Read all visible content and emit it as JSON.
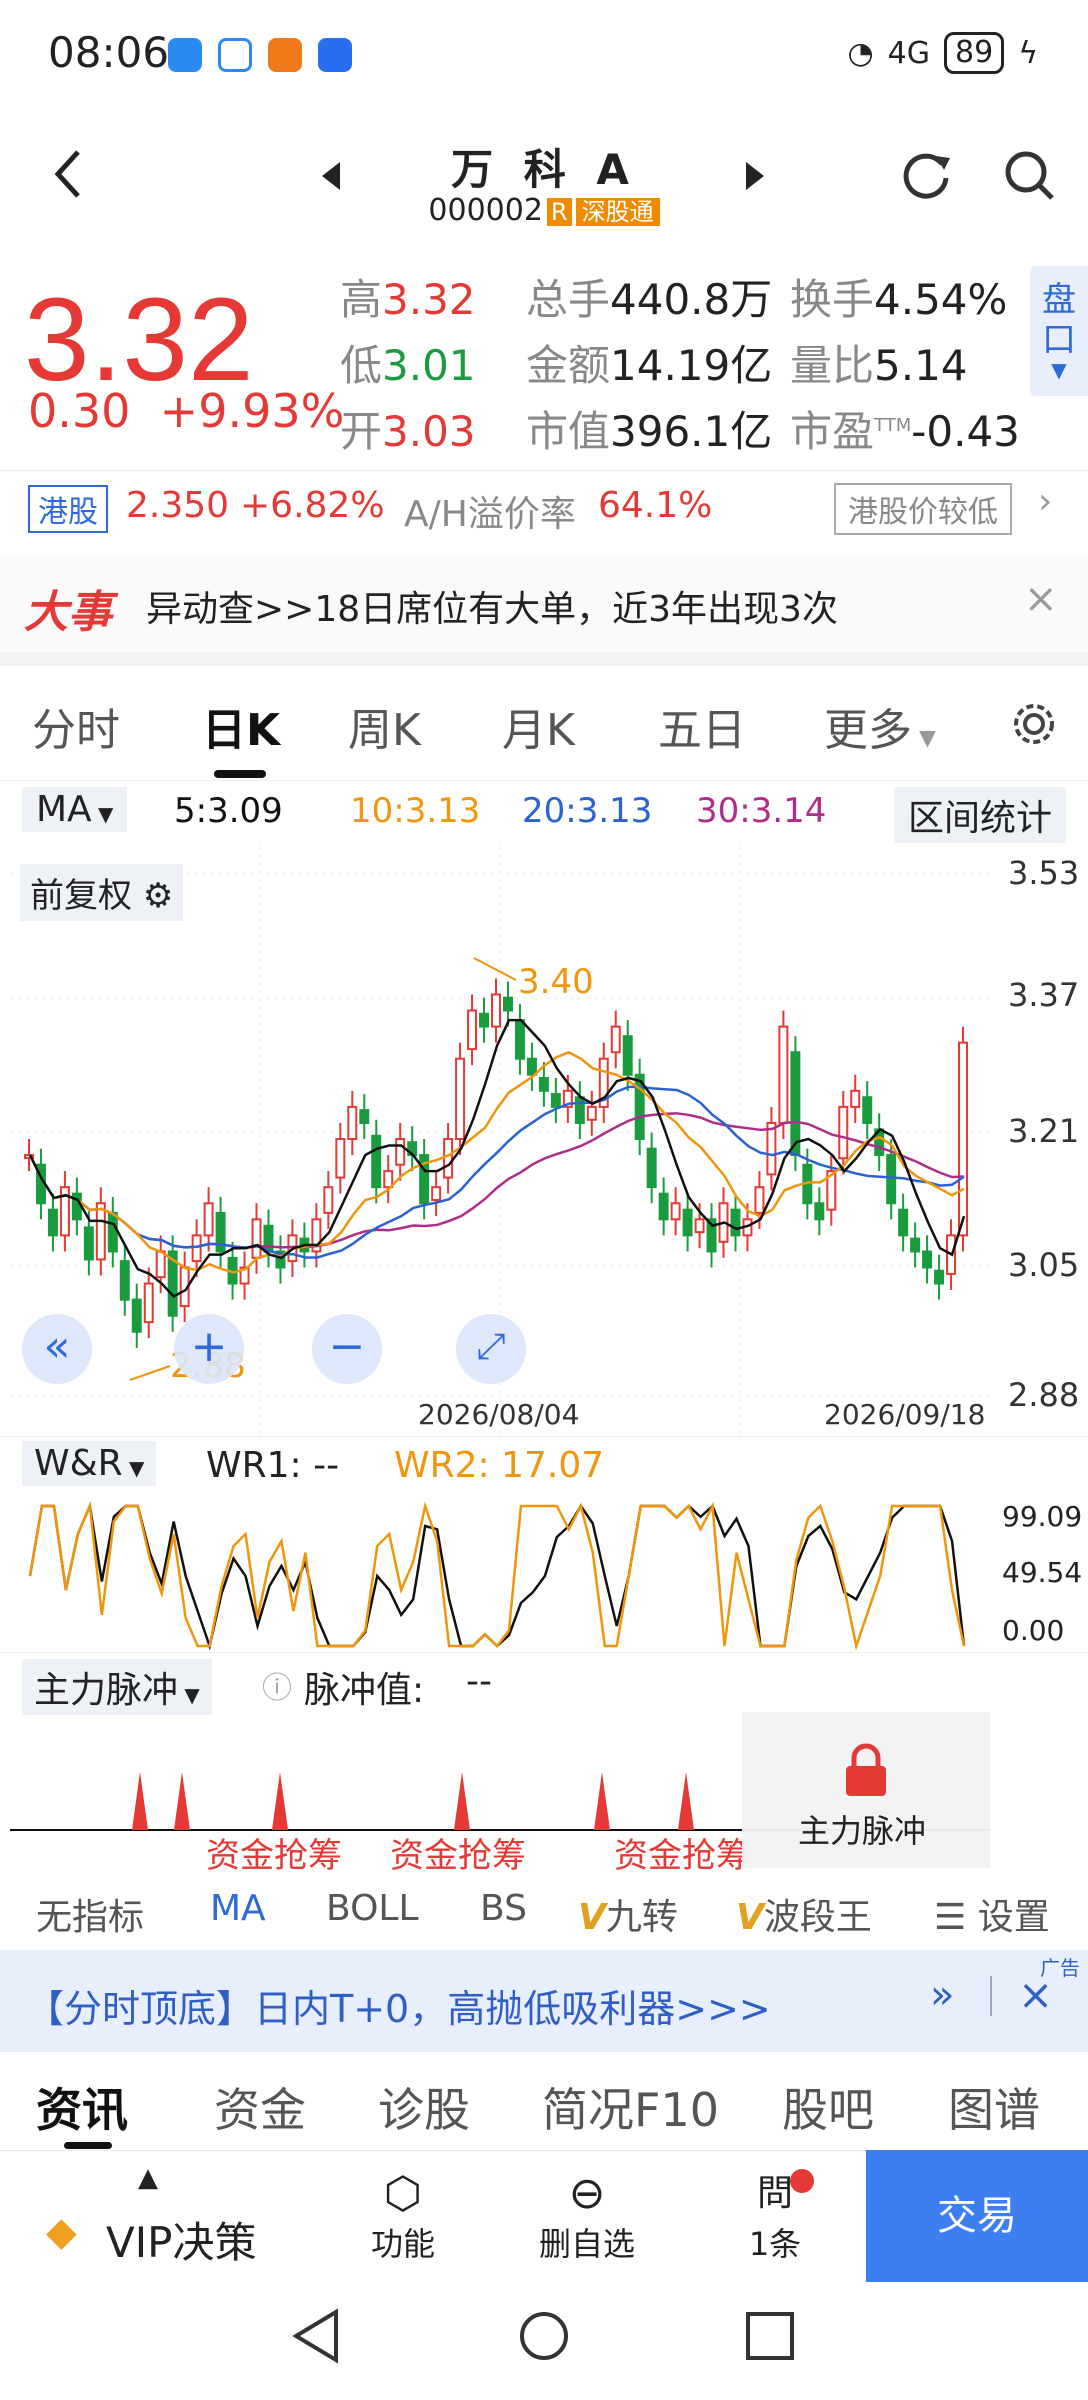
{
  "status_bar": {
    "time": "08:06",
    "network": "4G",
    "battery": "89"
  },
  "header": {
    "title": "万 科 A",
    "code": "000002",
    "tag_r": "R",
    "tag_sz": "深股通"
  },
  "quote": {
    "price": "3.32",
    "change": "0.30",
    "change_pct": "+9.93%",
    "high_label": "高",
    "high": "3.32",
    "low_label": "低",
    "low": "3.01",
    "open_label": "开",
    "open": "3.03",
    "volume_label": "总手",
    "volume": "440.8万",
    "amount_label": "金额",
    "amount": "14.19亿",
    "mcap_label": "市值",
    "mcap": "396.1亿",
    "turnover_label": "换手",
    "turnover": "4.54%",
    "vol_ratio_label": "量比",
    "vol_ratio": "5.14",
    "pe_label": "市盈",
    "pe_sup": "TTM",
    "pe": "-0.43",
    "side_tab": "盘口"
  },
  "hk": {
    "badge": "港股",
    "price": "2.350",
    "pct": "+6.82%",
    "ah_label": "A/H溢价率",
    "ah_value": "64.1%",
    "compare": "港股价较低"
  },
  "event": {
    "tag": "大事",
    "text": "异动查>>18日席位有大单，近3年出现3次"
  },
  "tabs": [
    "分时",
    "日K",
    "周K",
    "月K",
    "五日",
    "更多"
  ],
  "ma": {
    "label": "MA",
    "ma5": "5:3.09",
    "ma10": "10:3.13",
    "ma20": "20:3.13",
    "ma30": "30:3.14",
    "stats": "区间统计"
  },
  "kline": {
    "adjust": "前复权",
    "y_ticks": [
      "3.53",
      "3.37",
      "3.21",
      "3.05",
      "2.88"
    ],
    "date1": "2026/08/04",
    "date2": "2026/09/18",
    "high_mark": "3.40",
    "low_mark": "2.88"
  },
  "wr": {
    "label": "W&R",
    "wr1": "WR1: --",
    "wr2": "WR2: 17.07",
    "ticks": [
      "99.09",
      "49.54",
      "0.00"
    ]
  },
  "pulse": {
    "label": "主力脉冲",
    "value_label": "脉冲值:",
    "value": "--",
    "tags": [
      "资金抢筹",
      "资金抢筹",
      "资金抢筹"
    ],
    "lock_label": "主力脉冲"
  },
  "indicator_tabs": [
    "无指标",
    "MA",
    "BOLL",
    "BS",
    "九转",
    "波段王",
    "设置"
  ],
  "ad": {
    "text": "【分时顶底】日内T+0，高抛低吸利器>>>",
    "tag": "广告"
  },
  "news_tabs": [
    "资讯",
    "资金",
    "诊股",
    "简况F10",
    "股吧",
    "图谱"
  ],
  "bottom_bar": {
    "vip": "VIP决策",
    "func": "功能",
    "del": "删自选",
    "ask": "1条",
    "trade": "交易"
  },
  "colors": {
    "red": "#e53935",
    "green": "#1a9c3e",
    "ma5": "#111111",
    "ma10": "#f0960e",
    "ma20": "#2a62d2",
    "ma30": "#b02c8a"
  }
}
